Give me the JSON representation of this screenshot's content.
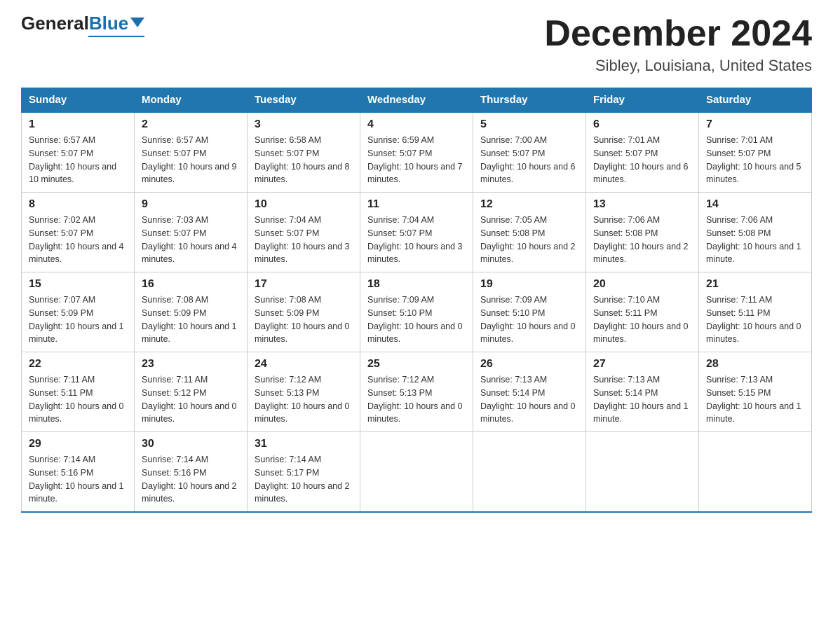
{
  "header": {
    "logo_general": "General",
    "logo_blue": "Blue",
    "logo_underline": "Blue",
    "month_title": "December 2024",
    "location": "Sibley, Louisiana, United States"
  },
  "weekdays": [
    "Sunday",
    "Monday",
    "Tuesday",
    "Wednesday",
    "Thursday",
    "Friday",
    "Saturday"
  ],
  "weeks": [
    [
      {
        "day": "1",
        "sunrise": "6:57 AM",
        "sunset": "5:07 PM",
        "daylight": "10 hours and 10 minutes."
      },
      {
        "day": "2",
        "sunrise": "6:57 AM",
        "sunset": "5:07 PM",
        "daylight": "10 hours and 9 minutes."
      },
      {
        "day": "3",
        "sunrise": "6:58 AM",
        "sunset": "5:07 PM",
        "daylight": "10 hours and 8 minutes."
      },
      {
        "day": "4",
        "sunrise": "6:59 AM",
        "sunset": "5:07 PM",
        "daylight": "10 hours and 7 minutes."
      },
      {
        "day": "5",
        "sunrise": "7:00 AM",
        "sunset": "5:07 PM",
        "daylight": "10 hours and 6 minutes."
      },
      {
        "day": "6",
        "sunrise": "7:01 AM",
        "sunset": "5:07 PM",
        "daylight": "10 hours and 6 minutes."
      },
      {
        "day": "7",
        "sunrise": "7:01 AM",
        "sunset": "5:07 PM",
        "daylight": "10 hours and 5 minutes."
      }
    ],
    [
      {
        "day": "8",
        "sunrise": "7:02 AM",
        "sunset": "5:07 PM",
        "daylight": "10 hours and 4 minutes."
      },
      {
        "day": "9",
        "sunrise": "7:03 AM",
        "sunset": "5:07 PM",
        "daylight": "10 hours and 4 minutes."
      },
      {
        "day": "10",
        "sunrise": "7:04 AM",
        "sunset": "5:07 PM",
        "daylight": "10 hours and 3 minutes."
      },
      {
        "day": "11",
        "sunrise": "7:04 AM",
        "sunset": "5:07 PM",
        "daylight": "10 hours and 3 minutes."
      },
      {
        "day": "12",
        "sunrise": "7:05 AM",
        "sunset": "5:08 PM",
        "daylight": "10 hours and 2 minutes."
      },
      {
        "day": "13",
        "sunrise": "7:06 AM",
        "sunset": "5:08 PM",
        "daylight": "10 hours and 2 minutes."
      },
      {
        "day": "14",
        "sunrise": "7:06 AM",
        "sunset": "5:08 PM",
        "daylight": "10 hours and 1 minute."
      }
    ],
    [
      {
        "day": "15",
        "sunrise": "7:07 AM",
        "sunset": "5:09 PM",
        "daylight": "10 hours and 1 minute."
      },
      {
        "day": "16",
        "sunrise": "7:08 AM",
        "sunset": "5:09 PM",
        "daylight": "10 hours and 1 minute."
      },
      {
        "day": "17",
        "sunrise": "7:08 AM",
        "sunset": "5:09 PM",
        "daylight": "10 hours and 0 minutes."
      },
      {
        "day": "18",
        "sunrise": "7:09 AM",
        "sunset": "5:10 PM",
        "daylight": "10 hours and 0 minutes."
      },
      {
        "day": "19",
        "sunrise": "7:09 AM",
        "sunset": "5:10 PM",
        "daylight": "10 hours and 0 minutes."
      },
      {
        "day": "20",
        "sunrise": "7:10 AM",
        "sunset": "5:11 PM",
        "daylight": "10 hours and 0 minutes."
      },
      {
        "day": "21",
        "sunrise": "7:11 AM",
        "sunset": "5:11 PM",
        "daylight": "10 hours and 0 minutes."
      }
    ],
    [
      {
        "day": "22",
        "sunrise": "7:11 AM",
        "sunset": "5:11 PM",
        "daylight": "10 hours and 0 minutes."
      },
      {
        "day": "23",
        "sunrise": "7:11 AM",
        "sunset": "5:12 PM",
        "daylight": "10 hours and 0 minutes."
      },
      {
        "day": "24",
        "sunrise": "7:12 AM",
        "sunset": "5:13 PM",
        "daylight": "10 hours and 0 minutes."
      },
      {
        "day": "25",
        "sunrise": "7:12 AM",
        "sunset": "5:13 PM",
        "daylight": "10 hours and 0 minutes."
      },
      {
        "day": "26",
        "sunrise": "7:13 AM",
        "sunset": "5:14 PM",
        "daylight": "10 hours and 0 minutes."
      },
      {
        "day": "27",
        "sunrise": "7:13 AM",
        "sunset": "5:14 PM",
        "daylight": "10 hours and 1 minute."
      },
      {
        "day": "28",
        "sunrise": "7:13 AM",
        "sunset": "5:15 PM",
        "daylight": "10 hours and 1 minute."
      }
    ],
    [
      {
        "day": "29",
        "sunrise": "7:14 AM",
        "sunset": "5:16 PM",
        "daylight": "10 hours and 1 minute."
      },
      {
        "day": "30",
        "sunrise": "7:14 AM",
        "sunset": "5:16 PM",
        "daylight": "10 hours and 2 minutes."
      },
      {
        "day": "31",
        "sunrise": "7:14 AM",
        "sunset": "5:17 PM",
        "daylight": "10 hours and 2 minutes."
      },
      null,
      null,
      null,
      null
    ]
  ]
}
